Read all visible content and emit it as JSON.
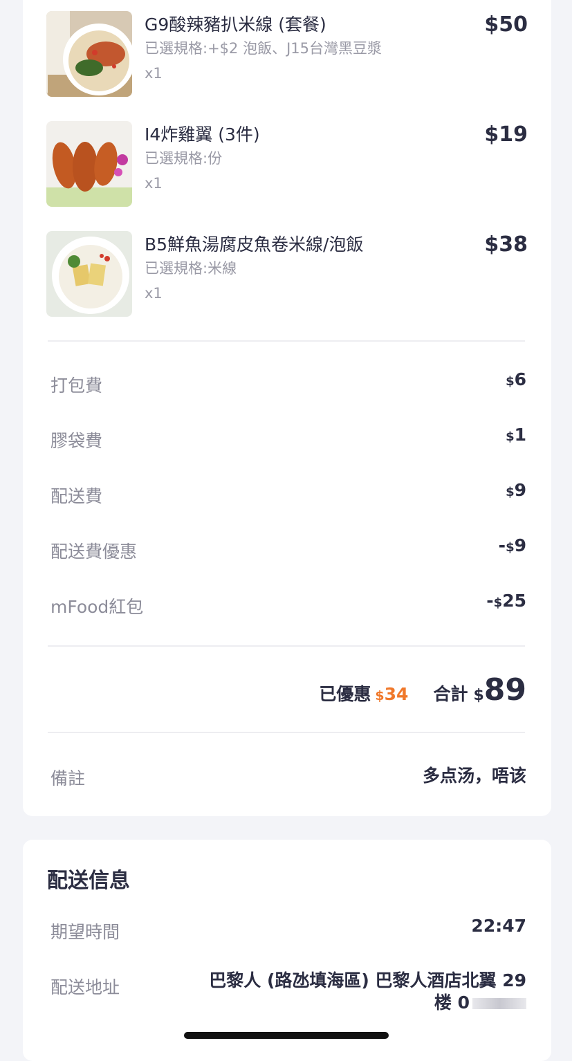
{
  "items": [
    {
      "name": "G9酸辣豬扒米線 (套餐)",
      "spec": "已選規格:+$2 泡飯、J15台灣黑豆漿",
      "qty": "x1",
      "price": "$50",
      "image": "noodle-soup-with-pork-chop-and-soy-milk"
    },
    {
      "name": "I4炸雞翼 (3件)",
      "spec": "已選規格:份",
      "qty": "x1",
      "price": "$19",
      "image": "fried-chicken-wings"
    },
    {
      "name": "B5鮮魚湯腐皮魚卷米線/泡飯",
      "spec": "已選規格:米線",
      "qty": "x1",
      "price": "$38",
      "image": "fish-soup-rice-noodles"
    }
  ],
  "fees": [
    {
      "label": "打包費",
      "sign": "",
      "currency": "$",
      "amount": "6"
    },
    {
      "label": "膠袋費",
      "sign": "",
      "currency": "$",
      "amount": "1"
    },
    {
      "label": "配送費",
      "sign": "",
      "currency": "$",
      "amount": "9"
    },
    {
      "label": "配送費優惠",
      "sign": "-",
      "currency": "$",
      "amount": "9"
    },
    {
      "label": "mFood紅包",
      "sign": "-",
      "currency": "$",
      "amount": "25"
    }
  ],
  "summary": {
    "discount_label": "已優惠",
    "discount_currency": "$",
    "discount_amount": "34",
    "total_label": "合計",
    "total_currency": "$",
    "total_amount": "89"
  },
  "remark": {
    "label": "備註",
    "value": "多点汤，唔该"
  },
  "delivery": {
    "title": "配送信息",
    "time_label": "期望時間",
    "time_value": "22:47",
    "address_label": "配送地址",
    "address_line1": "巴黎人 (路氹填海區) 巴黎人酒店北翼 29",
    "address_line2": "楼 0"
  },
  "colors": {
    "accent_discount": "#f0782a",
    "text_primary": "#2b2d42",
    "text_secondary": "#8c8c99",
    "background": "#f3f4f8"
  }
}
